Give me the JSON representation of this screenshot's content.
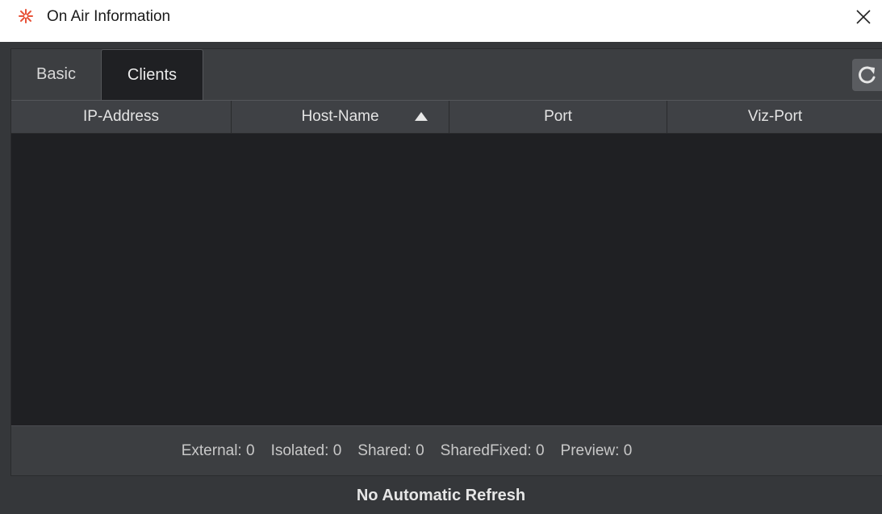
{
  "window": {
    "title": "On Air Information",
    "icon": "asterisk-logo-icon",
    "close_icon": "close-icon"
  },
  "tabs": [
    {
      "label": "Basic",
      "active": false
    },
    {
      "label": "Clients",
      "active": true
    }
  ],
  "toolbar": {
    "refresh_icon": "refresh-icon"
  },
  "table": {
    "columns": [
      {
        "label": "IP-Address"
      },
      {
        "label": "Host-Name",
        "sorted": "ascending"
      },
      {
        "label": "Port"
      },
      {
        "label": "Viz-Port"
      }
    ],
    "rows": []
  },
  "stats": [
    {
      "label": "External:",
      "value": "0"
    },
    {
      "label": "Isolated:",
      "value": "0"
    },
    {
      "label": "Shared:",
      "value": "0"
    },
    {
      "label": "SharedFixed:",
      "value": "0"
    },
    {
      "label": "Preview:",
      "value": "0"
    }
  ],
  "status": {
    "refresh_mode": "No Automatic Refresh"
  },
  "colors": {
    "background": "#35373a",
    "panel": "#3c3e41",
    "table_body": "#1f2023",
    "icon_accent": "#e8543a"
  }
}
